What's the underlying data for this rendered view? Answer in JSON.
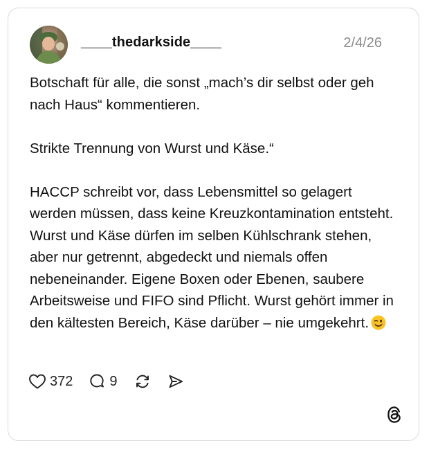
{
  "post": {
    "author": {
      "username": "____thedarkside____",
      "avatar": "avatar-image"
    },
    "date": "2/4/26",
    "paragraphs": [
      "Botschaft für alle, die sonst „mach’s dir selbst oder geh nach Haus“ kommentieren.",
      "Strikte Trennung von Wurst und Käse.“",
      "HACCP schreibt vor, dass Lebensmittel so gelagert werden müssen, dass keine Kreuzkontamination entsteht. Wurst und Käse dürfen im selben Kühlschrank stehen, aber nur getrennt, abgedeckt und niemals offen nebeneinander. Eigene Boxen oder Ebenen, saubere Arbeitsweise und FIFO sind Pflicht. Wurst gehört immer in den kältesten Bereich, Käse darüber – nie umgekehrt."
    ],
    "trailing_emoji": "winking-face-emoji",
    "actions": {
      "likes": "372",
      "replies": "9",
      "icons": [
        "heart-icon",
        "reply-icon",
        "repost-icon",
        "share-icon"
      ]
    },
    "brand_icon": "threads-logo-icon"
  },
  "colors": {
    "border": "#d9d9d9",
    "text": "#111111",
    "muted": "#8a8a8a",
    "emoji": "#f7c325"
  }
}
